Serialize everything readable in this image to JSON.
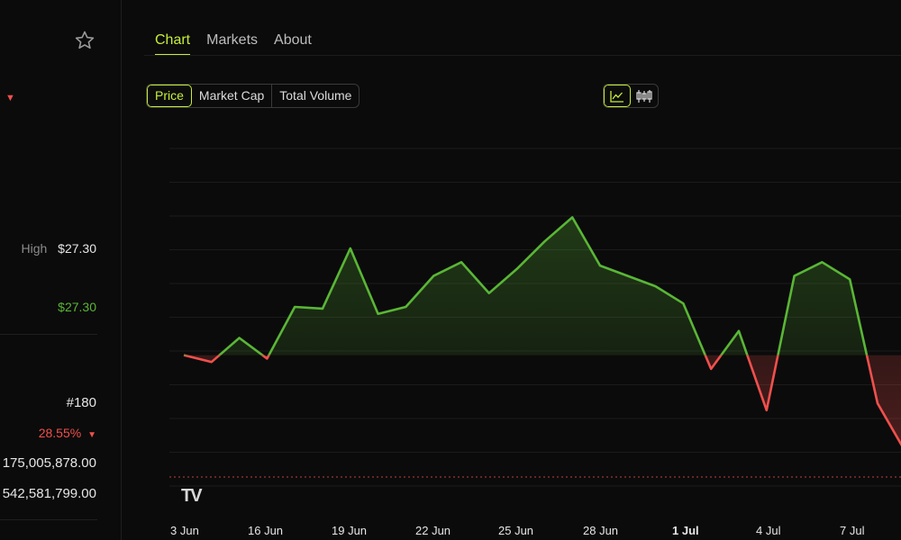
{
  "sidebar": {
    "high_label": "High",
    "high_value": "$27.30",
    "price_value": "$27.30",
    "rank": "#180",
    "change": "28.55%",
    "value_1": "175,005,878.00",
    "value_2": "542,581,799.00"
  },
  "tabs": [
    {
      "label": "Chart",
      "active": true
    },
    {
      "label": "Markets",
      "active": false
    },
    {
      "label": "About",
      "active": false
    }
  ],
  "metric_toggle": [
    {
      "label": "Price",
      "active": true
    },
    {
      "label": "Market Cap",
      "active": false
    },
    {
      "label": "Total Volume",
      "active": false
    }
  ],
  "chart_type_toggle": [
    {
      "icon": "line-chart-icon",
      "active": true
    },
    {
      "icon": "candlestick-icon",
      "active": false
    }
  ],
  "logo_text": "TV",
  "colors": {
    "accent": "#c6ee3a",
    "up": "#5ab636",
    "down": "#f0504d",
    "background": "#0b0b0b"
  },
  "chart_data": {
    "type": "line",
    "x_tick_labels": [
      "3 Jun",
      "16 Jun",
      "19 Jun",
      "22 Jun",
      "25 Jun",
      "28 Jun",
      "1 Jul",
      "4 Jul",
      "7 Jul"
    ],
    "x_tick_bold": [
      false,
      false,
      false,
      false,
      false,
      false,
      true,
      false,
      false
    ],
    "series": [
      {
        "values": [
          0.0,
          -0.2,
          0.5,
          -0.1,
          1.4,
          1.35,
          3.1,
          1.2,
          1.4,
          2.3,
          2.7,
          1.8,
          2.5,
          3.3,
          4.0,
          2.6,
          2.3,
          2.0,
          1.5,
          -0.4,
          0.7,
          -1.6,
          2.3,
          2.7,
          2.2,
          -1.4,
          -2.8
        ]
      }
    ],
    "baseline": 0.0,
    "above_baseline_color": "#5ab636",
    "below_baseline_color": "#f0504d",
    "ylim": [
      -3.8,
      6.0
    ],
    "grid": "horizontal",
    "legend": "none"
  }
}
